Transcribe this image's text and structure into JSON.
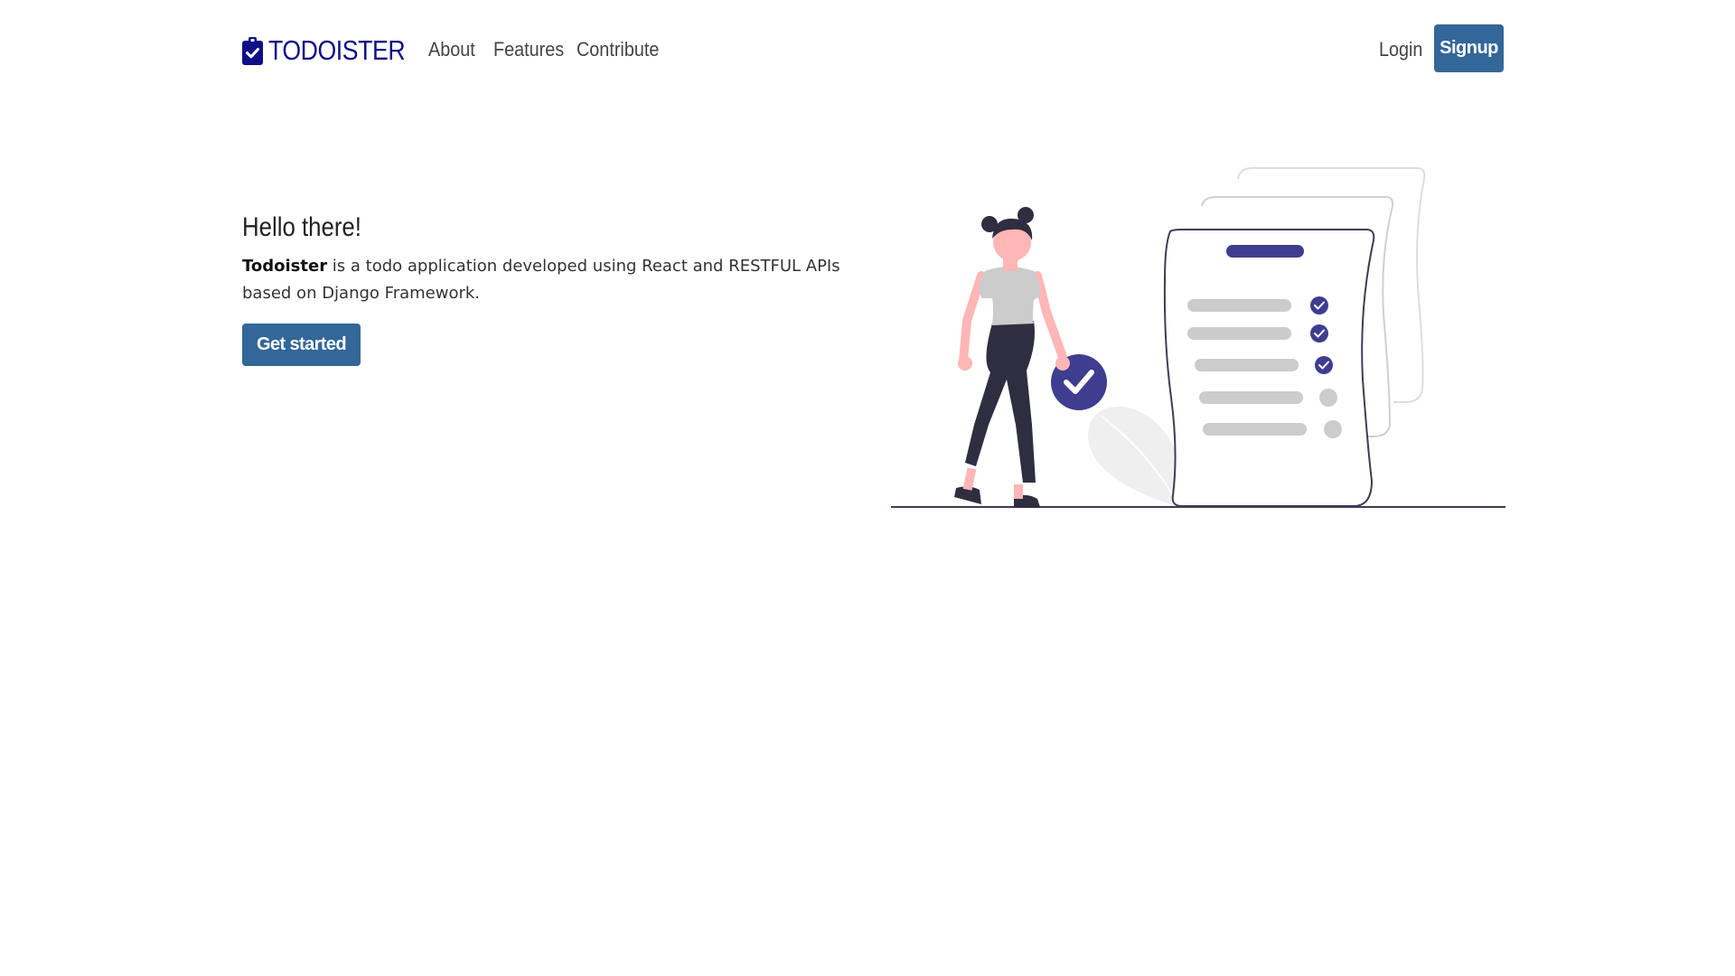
{
  "navbar": {
    "brand": {
      "icon": "clipboard-check-icon",
      "name": "TODOISTER",
      "color": "#0e0e86"
    },
    "links": [
      "About",
      "Features",
      "Contribute"
    ],
    "login_label": "Login",
    "signup_label": "Signup"
  },
  "hero": {
    "title": "Hello there!",
    "app_name": "Todoister",
    "description": " is a todo application developed using React and RESTFUL APIs based on Django Framework.",
    "cta_label": "Get started"
  },
  "illustration": {
    "name": "woman-with-checklist-illustration",
    "accent_color": "#3f3d8f",
    "checklist_items": [
      {
        "checked": true
      },
      {
        "checked": true
      },
      {
        "checked": true
      },
      {
        "checked": false
      },
      {
        "checked": false
      }
    ]
  },
  "colors": {
    "primary_button": "#336699",
    "brand": "#0e0e86",
    "text": "#333333"
  }
}
